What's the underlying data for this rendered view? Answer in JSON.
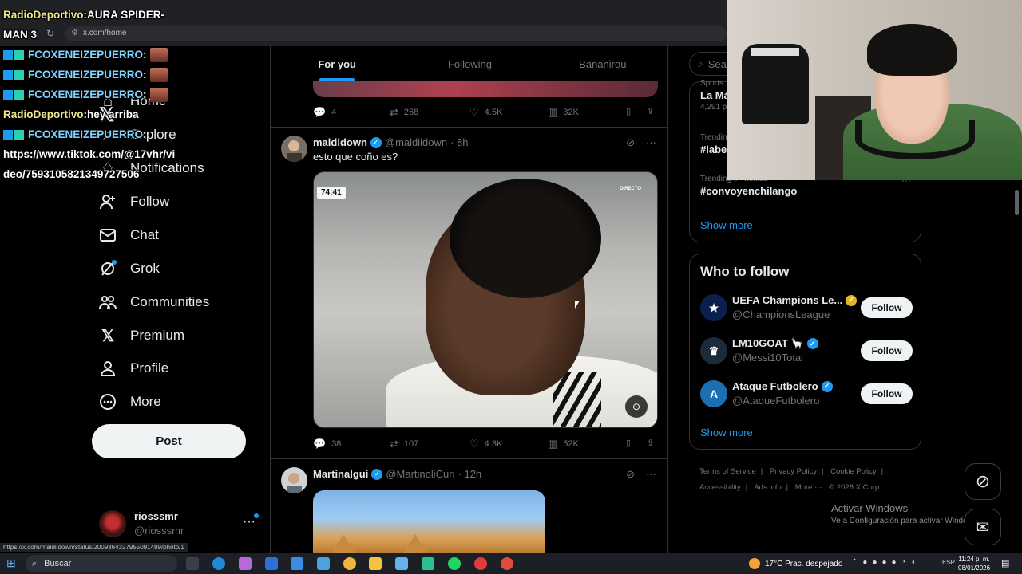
{
  "browser": {
    "url": "x.com/home",
    "status_url": "https://x.com/maldiidown/status/2009364327955091489/photo/1"
  },
  "chat_overlay": {
    "lines": [
      {
        "user": "RadioDeportivo",
        "sep": " : ",
        "text": "AURA SPIDER-"
      },
      {
        "user": "",
        "sep": "",
        "text": "MAN 3"
      },
      {
        "user": "FCOXENEIZEPUERRO",
        "sep": " : ",
        "text": ""
      },
      {
        "user": "FCOXENEIZEPUERRO",
        "sep": " : ",
        "text": ""
      },
      {
        "user": "FCOXENEIZEPUERRO",
        "sep": " : ",
        "text": ""
      },
      {
        "user": "RadioDeportivo",
        "sep": " : ",
        "text": "hey arriba"
      },
      {
        "user": "FCOXENEIZEPUERRO",
        "sep": " : ",
        "text": ""
      },
      {
        "user": "",
        "sep": "",
        "text": "https://www.tiktok.com/@17vhr/vi"
      },
      {
        "user": "",
        "sep": "",
        "text": "deo/7593105821349727506"
      }
    ]
  },
  "left_nav": {
    "logo": "𝕏",
    "items": [
      {
        "label": "Home",
        "icon": "home-icon"
      },
      {
        "label": "Explore",
        "icon": "search-icon"
      },
      {
        "label": "Notifications",
        "icon": "bell-icon"
      },
      {
        "label": "Follow",
        "icon": "person-plus-icon"
      },
      {
        "label": "Chat",
        "icon": "mail-icon"
      },
      {
        "label": "Grok",
        "icon": "grok-icon"
      },
      {
        "label": "Communities",
        "icon": "people-icon"
      },
      {
        "label": "Premium",
        "icon": "x-icon"
      },
      {
        "label": "Profile",
        "icon": "person-icon"
      },
      {
        "label": "More",
        "icon": "more-circle-icon"
      }
    ],
    "post_label": "Post",
    "account": {
      "name": "riosssmr",
      "handle": "@riosssmr"
    }
  },
  "feed": {
    "tabs": [
      {
        "label": "For you",
        "active": true
      },
      {
        "label": "Following",
        "active": false
      },
      {
        "label": "Bananirou",
        "active": false
      }
    ],
    "prev_tweet_actions": {
      "replies": "4",
      "reposts": "268",
      "likes": "4.5K",
      "views": "32K"
    },
    "tweet1": {
      "name": "maldidown",
      "handle": "@maldiidown",
      "time": "· 8h",
      "text": "esto que coño es?",
      "media_timer": "74:41",
      "media_live": "DIRECTO",
      "actions": {
        "replies": "38",
        "reposts": "107",
        "likes": "4.3K",
        "views": "52K"
      }
    },
    "tweet2": {
      "name": "Martinalgui",
      "handle": "@MartinoliCuri",
      "time": "· 12h"
    }
  },
  "right": {
    "search_placeholder": "Sea",
    "trends": [
      {
        "category": "Sports",
        "title": "La Má",
        "count": "4,291 p"
      },
      {
        "category": "Trendin",
        "title": "#labe",
        "count": ""
      },
      {
        "category": "Trending in Mexico",
        "title": "#convoyenchilango",
        "count": ""
      }
    ],
    "show_more": "Show more",
    "who_to_follow": {
      "title": "Who to follow",
      "accounts": [
        {
          "name": "UEFA Champions Le...",
          "handle": "@ChampionsLeague",
          "badge": "gold",
          "avatar_color": "#0b1f4d"
        },
        {
          "name": "LM10GOAT 🦙",
          "handle": "@Messi10Total",
          "badge": "blue",
          "avatar_color": "#1a2b3c"
        },
        {
          "name": "Ataque Futbolero",
          "handle": "@AtaqueFutbolero",
          "badge": "blue",
          "avatar_color": "#1a6fb0"
        }
      ],
      "follow_label": "Follow",
      "show_more": "Show more"
    },
    "footer": [
      "Terms of Service",
      "|",
      "Privacy Policy",
      "|",
      "Cookie Policy",
      "|",
      "Accessibility",
      "|",
      "Ads info",
      "|",
      "More ···",
      "© 2026 X Corp."
    ],
    "activate_windows": {
      "title": "Activar Windows",
      "subtitle": "Ve a Configuración para activar Windows."
    }
  },
  "taskbar": {
    "search_label": "Buscar",
    "weather": "17°C  Prac. despejado",
    "lang": "ESP",
    "time": "11:24 p. m.",
    "date": "08/01/2026"
  }
}
